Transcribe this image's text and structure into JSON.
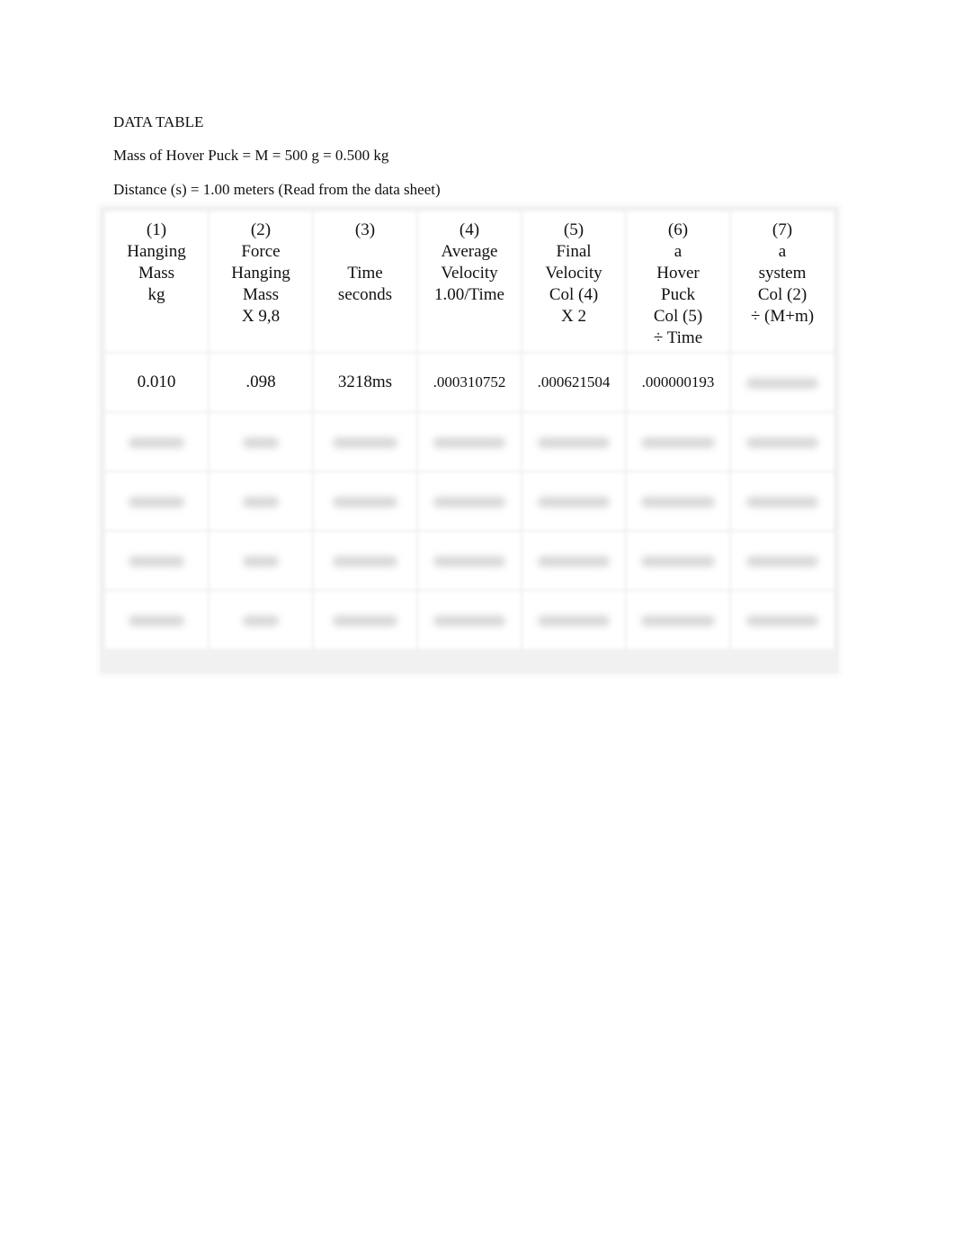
{
  "document": {
    "title": "DATA TABLE",
    "mass_line": "Mass of Hover Puck = M = 500 g = 0.500 kg",
    "distance_line": "Distance (s) = 1.00 meters (Read from the data sheet)"
  },
  "table": {
    "headers": [
      {
        "lines": [
          "(1)",
          "Hanging",
          "Mass",
          "kg"
        ]
      },
      {
        "lines": [
          "(2)",
          "Force",
          "Hanging",
          "Mass",
          "X 9,8"
        ]
      },
      {
        "lines": [
          "(3)",
          "",
          "Time",
          "seconds"
        ]
      },
      {
        "lines": [
          "(4)",
          "Average",
          "Velocity",
          "1.00/Time"
        ]
      },
      {
        "lines": [
          "(5)",
          "Final",
          "Velocity",
          "Col (4)",
          "X 2"
        ]
      },
      {
        "lines": [
          "(6)",
          "a",
          "Hover",
          "Puck",
          "Col (5)",
          "÷ Time"
        ]
      },
      {
        "lines": [
          "(7)",
          "a",
          "system",
          "Col (2)",
          "÷ (M+m)"
        ]
      }
    ],
    "rows": [
      {
        "cells": [
          {
            "value": "0.010",
            "blurred": false
          },
          {
            "value": ".098",
            "blurred": false
          },
          {
            "value": "3218ms",
            "blurred": false
          },
          {
            "value": ".000310752",
            "blurred": false
          },
          {
            "value": ".000621504",
            "blurred": false
          },
          {
            "value": ".000000193",
            "blurred": false
          },
          {
            "value": "",
            "blurred": true
          }
        ]
      },
      {
        "cells": [
          {
            "value": "",
            "blurred": true
          },
          {
            "value": "",
            "blurred": true
          },
          {
            "value": "",
            "blurred": true
          },
          {
            "value": "",
            "blurred": true
          },
          {
            "value": "",
            "blurred": true
          },
          {
            "value": "",
            "blurred": true
          },
          {
            "value": "",
            "blurred": true
          }
        ]
      },
      {
        "cells": [
          {
            "value": "",
            "blurred": true
          },
          {
            "value": "",
            "blurred": true
          },
          {
            "value": "",
            "blurred": true
          },
          {
            "value": "",
            "blurred": true
          },
          {
            "value": "",
            "blurred": true
          },
          {
            "value": "",
            "blurred": true
          },
          {
            "value": "",
            "blurred": true
          }
        ]
      },
      {
        "cells": [
          {
            "value": "",
            "blurred": true
          },
          {
            "value": "",
            "blurred": true
          },
          {
            "value": "",
            "blurred": true
          },
          {
            "value": "",
            "blurred": true
          },
          {
            "value": "",
            "blurred": true
          },
          {
            "value": "",
            "blurred": true
          },
          {
            "value": "",
            "blurred": true
          }
        ]
      },
      {
        "cells": [
          {
            "value": "",
            "blurred": true
          },
          {
            "value": "",
            "blurred": true
          },
          {
            "value": "",
            "blurred": true
          },
          {
            "value": "",
            "blurred": true
          },
          {
            "value": "",
            "blurred": true
          },
          {
            "value": "",
            "blurred": true
          },
          {
            "value": "",
            "blurred": true
          }
        ]
      }
    ]
  }
}
